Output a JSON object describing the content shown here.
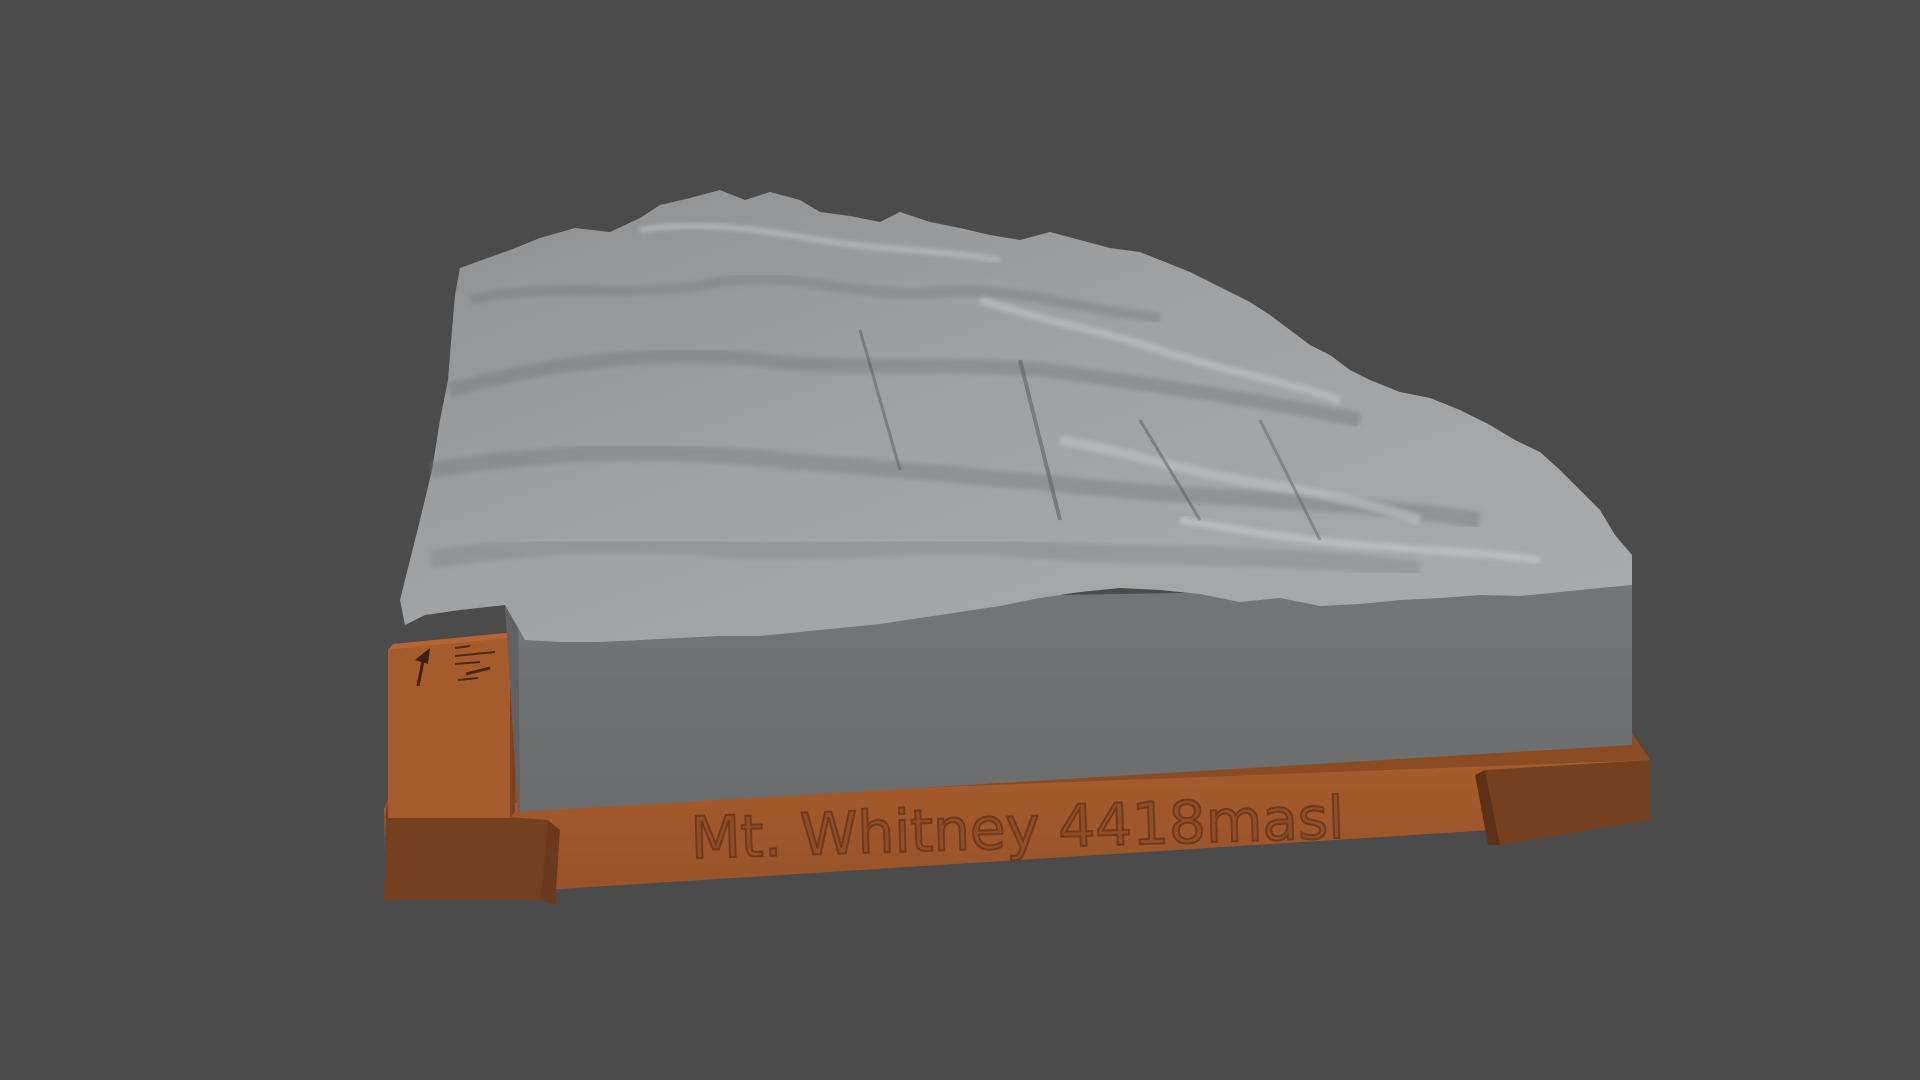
{
  "scene": {
    "plaque_text": "Mt. Whitney 4418masl",
    "colors": {
      "background": "#4b4b4b",
      "terrain_light": "#a6a8aa",
      "terrain_mid": "#8b8d8f",
      "terrain_shadow": "#6b6d6f",
      "terrain_wall": "#6e7071",
      "base_front": "#a2592a",
      "base_dark": "#6b3a1d",
      "base_mid": "#8b4b23"
    },
    "icons": [
      "north-arrow-icon",
      "scale-legend-icon"
    ]
  }
}
